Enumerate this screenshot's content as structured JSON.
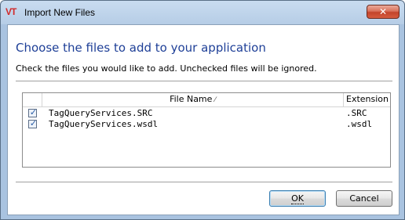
{
  "window": {
    "app_logo": "VT",
    "title": "Import New Files",
    "close_glyph": "✕"
  },
  "dialog": {
    "heading": "Choose the files to add to your application",
    "instruction": "Check the files you would like to add. Unchecked files will be ignored."
  },
  "list": {
    "columns": {
      "name": "File Name",
      "extension": "Extension"
    },
    "sort_indicator": "sort-ascending-icon",
    "rows": [
      {
        "checked": true,
        "name": "TagQueryServices.SRC",
        "extension": ".SRC"
      },
      {
        "checked": true,
        "name": "TagQueryServices.wsdl",
        "extension": ".wsdl"
      }
    ]
  },
  "buttons": {
    "ok": "OK",
    "cancel": "Cancel"
  },
  "colors": {
    "heading": "#1e3f97",
    "frame": "#a9c3e0",
    "close": "#c3442a"
  }
}
